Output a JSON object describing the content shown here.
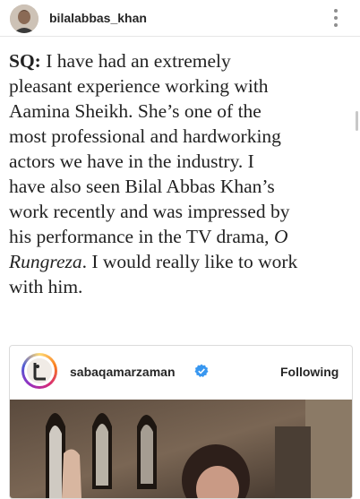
{
  "header": {
    "username": "bilalabbas_khan",
    "avatar_icon": "profile-photo",
    "more_icon": "vertical-ellipsis-icon"
  },
  "article": {
    "lines": [
      {
        "bold": "SQ:",
        "text": " I have had an extremely",
        "italic": ""
      },
      {
        "bold": "",
        "text": "pleasant experience working with",
        "italic": ""
      },
      {
        "bold": "",
        "text": "Aamina Sheikh. She’s one of the",
        "italic": ""
      },
      {
        "bold": "",
        "text": "most professional and hardworking",
        "italic": ""
      },
      {
        "bold": "",
        "text": "actors we have in the industry. I",
        "italic": ""
      },
      {
        "bold": "",
        "text": "have also seen Bilal Abbas Khan’s",
        "italic": ""
      },
      {
        "bold": "",
        "text": "work recently and was impressed by",
        "italic": ""
      },
      {
        "bold": "",
        "text": "his performance in the TV drama, ",
        "italic": "O"
      },
      {
        "bold": "",
        "italic_lead": "Rungreza",
        "text": ". I would really like to work",
        "italic": ""
      },
      {
        "bold": "",
        "text": "with him.",
        "italic": ""
      }
    ]
  },
  "embed": {
    "username": "sabaqamarzaman",
    "follow_label": "Following",
    "verified_icon": "verified-badge-icon",
    "verified_color": "#3897f0",
    "ring_colors": [
      "#feda75",
      "#fa7e1e",
      "#d62976",
      "#962fbf",
      "#4f5bd5"
    ]
  }
}
